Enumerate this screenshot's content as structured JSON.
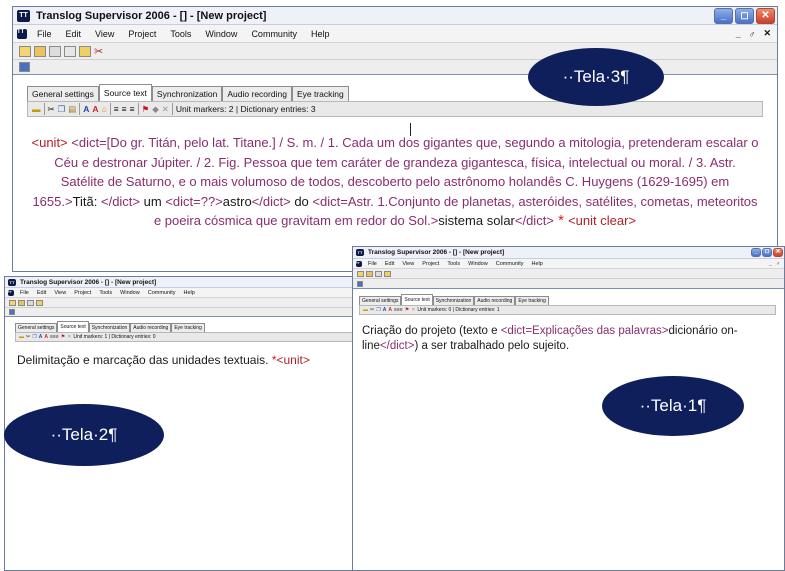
{
  "app": {
    "title": "Translog Supervisor 2006 - [] - [New project]",
    "title_small": "Translog Supervisor 2006 - [] - [New project]",
    "window_controls": [
      "_",
      "☐",
      "✕"
    ],
    "mdi_controls": [
      "_",
      "♂",
      "✕"
    ]
  },
  "menu": [
    "File",
    "Edit",
    "View",
    "Project",
    "Tools",
    "Window",
    "Community",
    "Help"
  ],
  "tabs": [
    "General settings",
    "Source text",
    "Synchronization",
    "Audio recording",
    "Eye tracking"
  ],
  "format_bar": {
    "status_main": "Unit markers: 2 | Dictionary entries: 3",
    "status_left": "Unit markers: 1 | Dictionary entries: 0",
    "status_right": "Unit markers: 0 | Dictionary entries: 1"
  },
  "tela3": {
    "label": "··Tela·3¶",
    "text": {
      "p1_unit": "<unit>",
      "p1_dict": " <dict=[Do gr. Titán, pelo lat. Titane.] / S. m. / 1. Cada um dos gigantes que, segundo a mitologia, pretenderam escalar o Céu e destronar Júpiter. / 2. Fig.  Pessoa que tem caráter de grandeza gigantesca, física, intelectual ou moral. / 3. Astr.  Satélite de Saturno, e o mais volumoso de todos, descoberto pelo astrônomo holandês C. Huygens (1629-1695) em 1655.>",
      "p1_word": "Titã: ",
      "p1_close": "</dict>",
      "p2_um": " um ",
      "p2_dict_open": "<dict=??>",
      "p2_astro": "astro",
      "p2_dict_close": "</dict>",
      "p2_do": " do ",
      "p2_dict2": "<dict=Astr.  1.Conjunto de planetas, asteróides, satélites, cometas, meteoritos e poeira cósmica que gravitam em redor do Sol.>",
      "p2_sistema": "sistema solar",
      "p2_close": "</dict>",
      "p2_star": " * ",
      "p2_clear": "<unit clear>"
    }
  },
  "tela2": {
    "label": "··Tela·2¶",
    "text": "Delimitação e marcação das unidades textuais. ",
    "star": "*",
    "unit": "<unit>"
  },
  "tela1": {
    "label": "··Tela·1¶",
    "text_a": "Criação do projeto (texto e ",
    "dict_open": "<dict=Explicações das palavras>",
    "text_b": "dicionário on-line",
    "dict_close": "</dict>",
    "text_c": ") a ser trabalhado pelo sujeito."
  },
  "colors": {
    "markup_red": "#b0202a",
    "dict_purple": "#8a2d70",
    "oval_navy": "#0f1f5c",
    "asterisk": "#e01818"
  }
}
